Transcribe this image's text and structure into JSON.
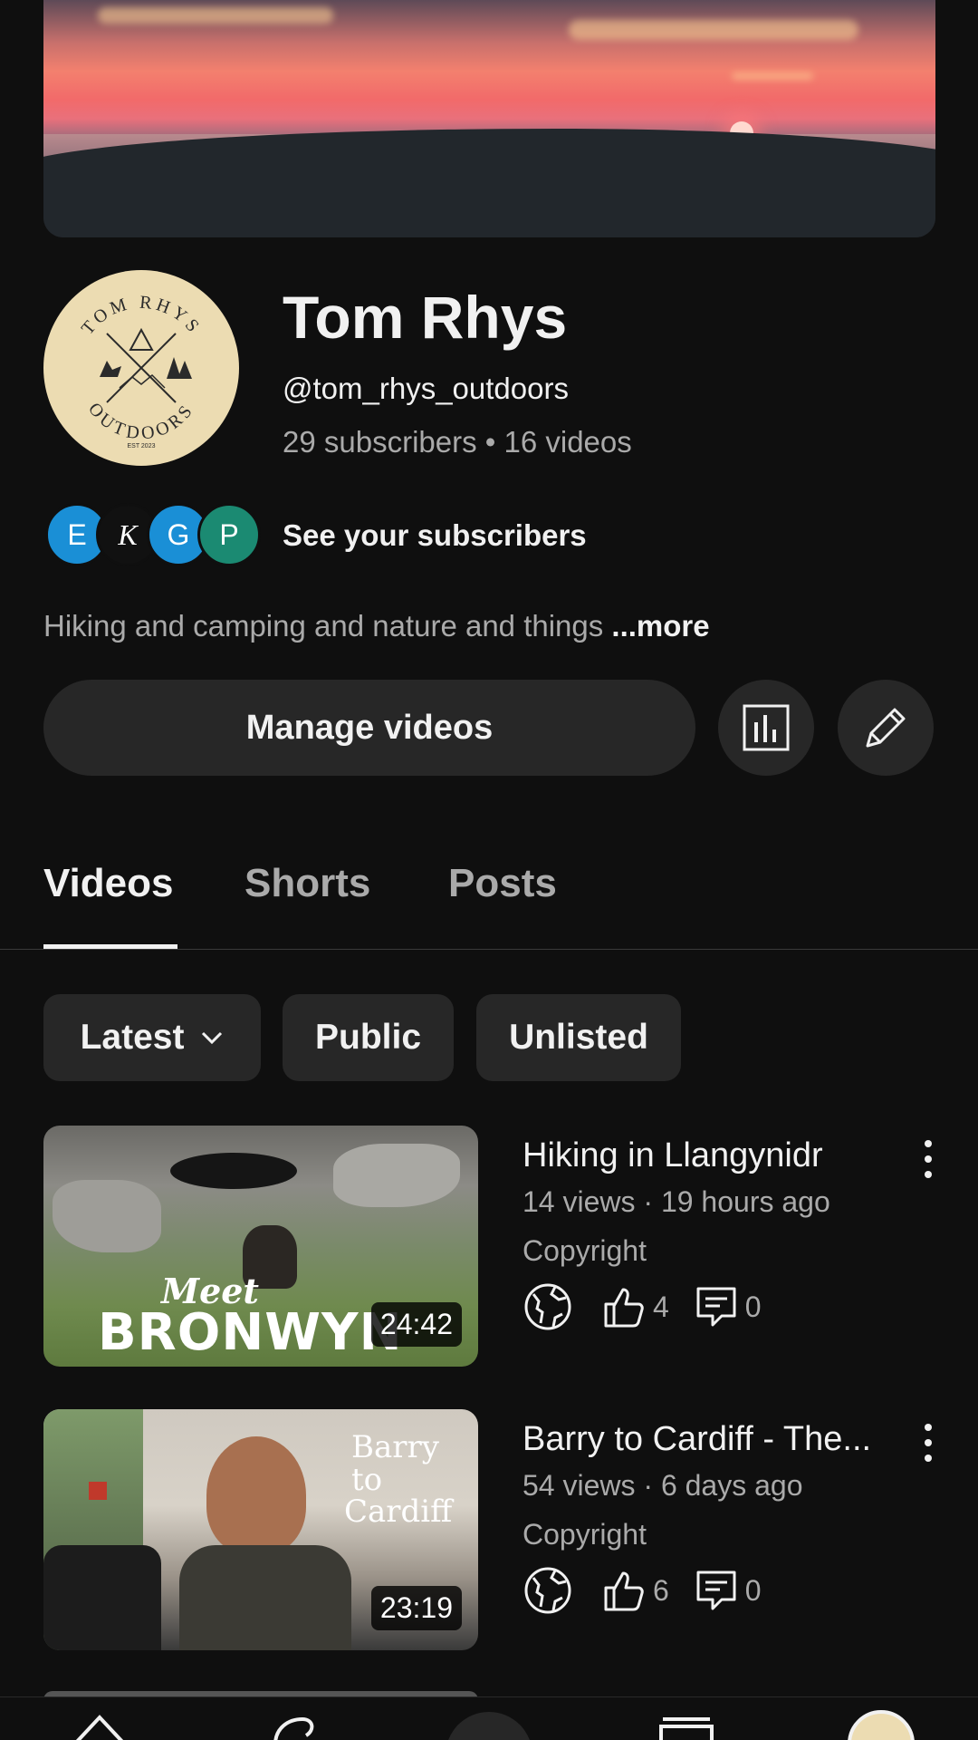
{
  "channel": {
    "name": "Tom Rhys",
    "handle": "@tom_rhys_outdoors",
    "stats": "29 subscribers • 16 videos",
    "logo_text_top": "TOM RHYS",
    "logo_text_bottom": "OUTDOORS",
    "logo_est": "EST 2023",
    "see_subscribers": "See your subscribers",
    "subscriber_avatars": [
      {
        "letter": "E",
        "color": "#1a8fd6"
      },
      {
        "letter": "K",
        "color": "#111111"
      },
      {
        "letter": "G",
        "color": "#1a8fd6"
      },
      {
        "letter": "P",
        "color": "#1b8a72"
      }
    ],
    "description": "Hiking and camping and nature and things ",
    "more_label": "...more"
  },
  "actions": {
    "manage_videos": "Manage videos",
    "analytics_icon": "analytics-icon",
    "edit_icon": "pencil-icon"
  },
  "tabs": [
    {
      "label": "Videos",
      "active": true
    },
    {
      "label": "Shorts",
      "active": false
    },
    {
      "label": "Posts",
      "active": false
    }
  ],
  "filters": {
    "sort": "Latest",
    "public": "Public",
    "unlisted": "Unlisted"
  },
  "videos": [
    {
      "title": "Hiking in Llangynidr",
      "meta": "14 views · 19 hours ago",
      "copyright": "Copyright",
      "duration": "24:42",
      "likes": "4",
      "comments": "0",
      "thumb_text_1": "Meet",
      "thumb_text_2": "BRONWYN"
    },
    {
      "title": "Barry to Cardiff - The...",
      "meta": "54 views · 6 days ago",
      "copyright": "Copyright",
      "duration": "23:19",
      "likes": "6",
      "comments": "0",
      "thumb_text_1": "Barry",
      "thumb_text_2": "to",
      "thumb_text_3": "Cardiff"
    }
  ],
  "colors": {
    "background": "#0f0f0f",
    "surface": "#272727",
    "text_primary": "#f1f1f1",
    "text_secondary": "#aaaaaa"
  }
}
